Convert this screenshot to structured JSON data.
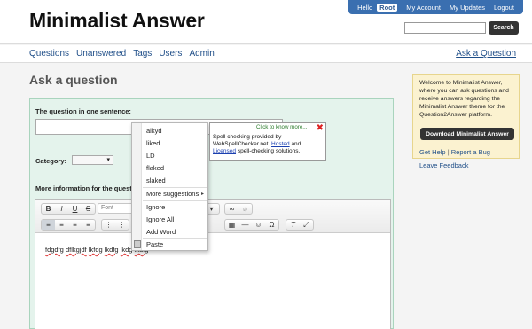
{
  "header": {
    "site_title": "Minimalist Answer",
    "userbar": {
      "hello": "Hello",
      "username": "Root",
      "my_account": "My Account",
      "my_updates": "My Updates",
      "logout": "Logout"
    },
    "search_button": "Search"
  },
  "nav": {
    "items": [
      "Questions",
      "Unanswered",
      "Tags",
      "Users",
      "Admin"
    ],
    "ask_link": "Ask a Question"
  },
  "page_title": "Ask a question",
  "form": {
    "question_label": "The question in one sentence:",
    "category_label": "Category:",
    "category_value": "",
    "more_info_label": "More information for the question:",
    "font_placeholder": "Font",
    "editor_words": [
      "fdgdfg",
      "dflkgjdf",
      "lkfdg",
      "lkdfg",
      "lkdg",
      "lkdfg"
    ]
  },
  "context_menu": {
    "suggestions": [
      "alkyd",
      "liked",
      "LD",
      "flaked",
      "slaked"
    ],
    "more_suggestions": "More suggestions",
    "ignore": "Ignore",
    "ignore_all": "Ignore All",
    "add_word": "Add Word",
    "paste": "Paste"
  },
  "spellcheck_popup": {
    "click_more": "Click to know more...",
    "line1": "Spell checking provided by",
    "line2_pre": "WebSpellChecker.net.",
    "hosted": "Hosted",
    "and": "and",
    "licensed": "Licensed",
    "line3_post": "spell-checking solutions."
  },
  "sidebar": {
    "welcome": "Welcome to Minimalist Answer, where you can ask questions and receive answers regarding the Minimalist Answer theme for the Question2Answer platform.",
    "download_button": "Download Minimalist Answer",
    "get_help": "Get Help",
    "separator": "|",
    "report_bug": "Report a Bug",
    "leave_feedback": "Leave Feedback"
  },
  "colors": {
    "form_bg": "#e4f3ec",
    "sidebar_bg": "#fbf2d0",
    "userbar_bg": "#3a6fb0",
    "link": "#1f4e88"
  }
}
